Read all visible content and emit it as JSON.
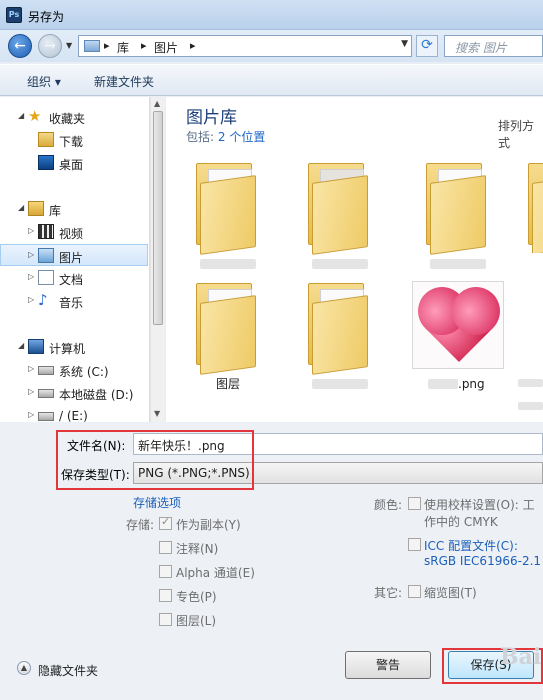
{
  "window": {
    "title": "另存为",
    "app_icon_text": "Ps"
  },
  "address_bar": {
    "breadcrumbs": [
      "库",
      "图片"
    ],
    "search_placeholder": "搜索 图片"
  },
  "toolbar": {
    "organize": "组织 ▾",
    "new_folder": "新建文件夹"
  },
  "nav": {
    "items": [
      {
        "label": "收藏夹",
        "icon": "star-icon",
        "level": 0
      },
      {
        "label": "下载",
        "icon": "downloads-folder-icon",
        "level": 1
      },
      {
        "label": "桌面",
        "icon": "desktop-icon",
        "level": 1
      },
      {
        "label": "库",
        "icon": "library-icon",
        "level": 0
      },
      {
        "label": "视频",
        "icon": "video-library-icon",
        "level": 1
      },
      {
        "label": "图片",
        "icon": "pictures-library-icon",
        "level": 1,
        "selected": true
      },
      {
        "label": "文档",
        "icon": "documents-library-icon",
        "level": 1
      },
      {
        "label": "音乐",
        "icon": "music-library-icon",
        "level": 1
      },
      {
        "label": "计算机",
        "icon": "computer-icon",
        "level": 0
      },
      {
        "label": "系统 (C:)",
        "icon": "drive-icon",
        "level": 1
      },
      {
        "label": "本地磁盘 (D:)",
        "icon": "drive-icon",
        "level": 1
      },
      {
        "label": "/ (E:)",
        "icon": "drive-icon",
        "level": 1
      }
    ]
  },
  "content": {
    "library_title": "图片库",
    "includes_label": "包括:",
    "includes_count": "2 个位置",
    "arrange_label": "排列方式",
    "files": [
      {
        "label": "",
        "kind": "folder"
      },
      {
        "label": "",
        "kind": "folder"
      },
      {
        "label": "",
        "kind": "folder"
      },
      {
        "label": "图层",
        "kind": "folder"
      },
      {
        "label": "",
        "kind": "folder"
      },
      {
        "label": ".png",
        "kind": "image"
      }
    ]
  },
  "form": {
    "filename_label": "文件名(N):",
    "filename_value": "新年快乐！.png",
    "filetype_label": "保存类型(T):",
    "filetype_value": "PNG (*.PNG;*.PNS)"
  },
  "options": {
    "storage_options_link": "存储选项",
    "storage_label": "存储:",
    "as_copy": "作为副本(Y)",
    "annotations": "注释(N)",
    "alpha": "Alpha 通道(E)",
    "spot": "专色(P)",
    "layers": "图层(L)",
    "color_label": "颜色:",
    "proof_setup_1": "使用校样设置(O):  工",
    "proof_setup_2": "作中的 CMYK",
    "icc_1": "ICC 配置文件(C):",
    "icc_2": "sRGB IEC61966-2.1",
    "other_label": "其它:",
    "thumbnail": "缩览图(T)"
  },
  "footer": {
    "hide_folders": "隐藏文件夹",
    "warning_button": "警告",
    "save_button": "保存(S)",
    "watermark": "Bai"
  },
  "colors": {
    "highlight": "#e2363a",
    "link": "#1b5fb8"
  }
}
